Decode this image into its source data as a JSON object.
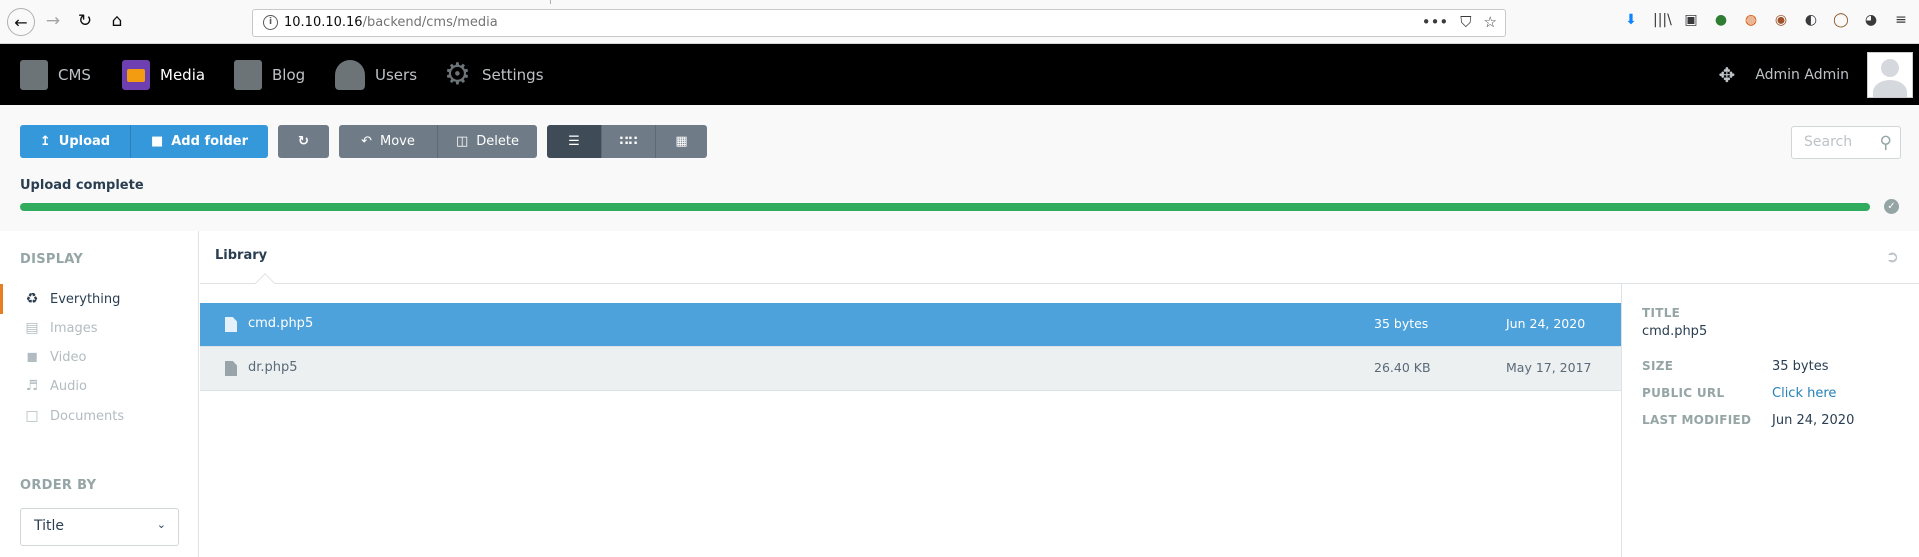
{
  "browser": {
    "url_host": "10.10.10.16",
    "url_path": "/backend/cms/media",
    "url_actions": [
      "•••",
      "⛉",
      "☆"
    ],
    "tools": [
      "⬇",
      "|||\\",
      "▣",
      "●",
      "◍",
      "◉",
      "◐",
      "◯",
      "◕",
      "≡"
    ],
    "tool_colors": [
      "#0a84ff",
      "#3a3a3c",
      "#3a3a3c",
      "#2e7d32",
      "#d35400",
      "#a0522d",
      "#3a3a3c",
      "#8e5a2b",
      "#3a3a3c",
      "#3a3a3c"
    ]
  },
  "navbar": {
    "items": [
      {
        "label": "CMS",
        "icon": "cms-icon",
        "active": false
      },
      {
        "label": "Media",
        "icon": "media-icon",
        "active": true
      },
      {
        "label": "Blog",
        "icon": "blog-icon",
        "active": false
      },
      {
        "label": "Users",
        "icon": "users-icon",
        "active": false
      },
      {
        "label": "Settings",
        "icon": "settings-icon",
        "active": false
      }
    ],
    "user_name": "Admin Admin"
  },
  "toolbar": {
    "upload_label": "Upload",
    "add_folder_label": "Add folder",
    "move_label": "Move",
    "delete_label": "Delete",
    "search_placeholder": "Search"
  },
  "upload": {
    "status": "Upload complete",
    "progress": 1.0
  },
  "sidebar": {
    "display_heading": "DISPLAY",
    "items": [
      {
        "label": "Everything",
        "icon": "recycle-icon",
        "active": true
      },
      {
        "label": "Images",
        "icon": "image-icon",
        "active": false
      },
      {
        "label": "Video",
        "icon": "video-icon",
        "active": false
      },
      {
        "label": "Audio",
        "icon": "audio-icon",
        "active": false
      },
      {
        "label": "Documents",
        "icon": "document-icon",
        "active": false
      }
    ],
    "order_heading": "ORDER BY",
    "order_value": "Title"
  },
  "library": {
    "title": "Library",
    "files": [
      {
        "name": "cmd.php5",
        "size": "35 bytes",
        "date": "Jun 24, 2020",
        "selected": true
      },
      {
        "name": "dr.php5",
        "size": "26.40 KB",
        "date": "May 17, 2017",
        "selected": false
      }
    ]
  },
  "details": {
    "title_label": "TITLE",
    "title_value": "cmd.php5",
    "size_label": "SIZE",
    "size_value": "35 bytes",
    "url_label": "PUBLIC URL",
    "url_value": "Click here",
    "modified_label": "LAST MODIFIED",
    "modified_value": "Jun 24, 2020"
  },
  "colors": {
    "accent_blue": "#3498db",
    "progress_green": "#31ac5f",
    "selected_row": "#4da2dc",
    "active_marker": "#e67e22"
  }
}
